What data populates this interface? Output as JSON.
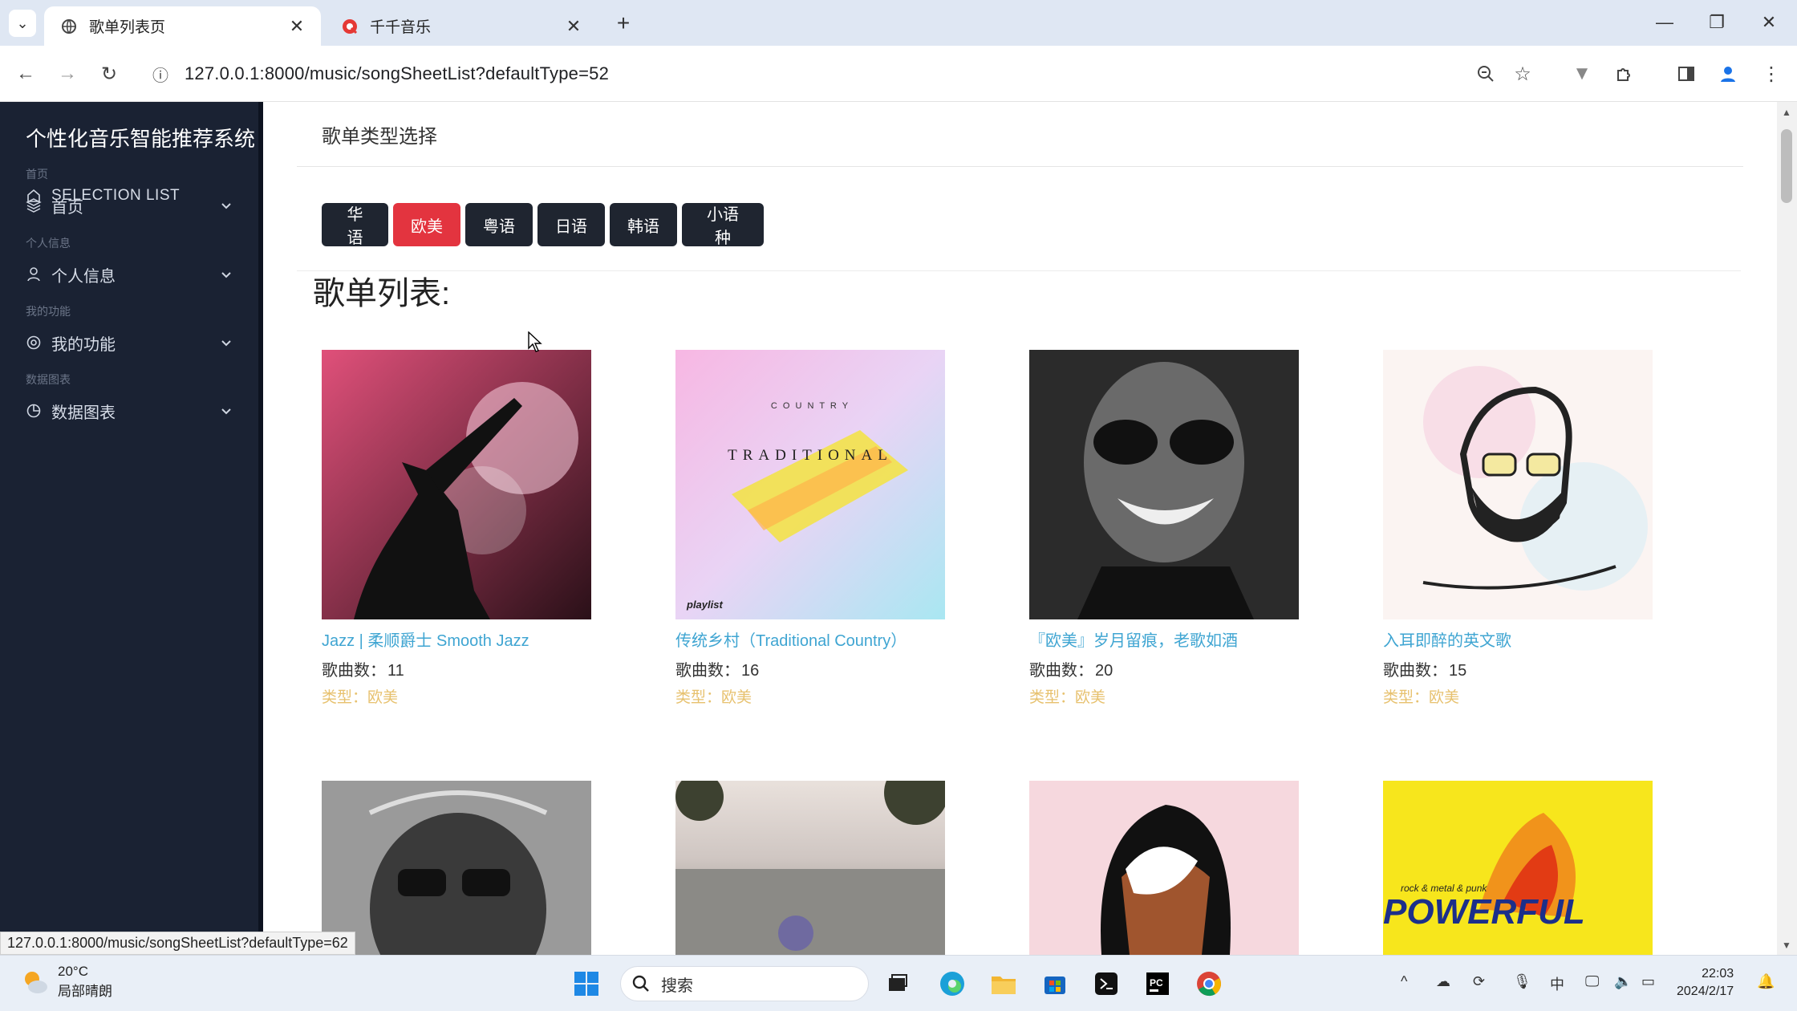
{
  "browser": {
    "tabs": [
      {
        "title": "歌单列表页",
        "active": true
      },
      {
        "title": "千千音乐",
        "active": false
      }
    ],
    "address": "127.0.0.1:8000/music/songSheetList?defaultType=52",
    "status_url": "127.0.0.1:8000/music/songSheetList?defaultType=62"
  },
  "sidebar": {
    "brand": "个性化音乐智能推荐系统",
    "selection_list": "SELECTION LIST",
    "sections": [
      {
        "header": "首页",
        "item": "首页",
        "icon": "layers-icon"
      },
      {
        "header": "个人信息",
        "item": "个人信息",
        "icon": "user-icon"
      },
      {
        "header": "我的功能",
        "item": "我的功能",
        "icon": "settings-icon"
      },
      {
        "header": "数据图表",
        "item": "数据图表",
        "icon": "pie-chart-icon"
      }
    ]
  },
  "main": {
    "type_heading": "歌单类型选择",
    "types": [
      "华语",
      "欧美",
      "粤语",
      "日语",
      "韩语",
      "小语种"
    ],
    "active_type": "欧美",
    "list_title": "歌单列表:",
    "count_label": "歌曲数：",
    "type_label": "类型：",
    "sheets": [
      {
        "title": "Jazz | 柔顺爵士 Smooth Jazz",
        "count": "11",
        "type": "欧美"
      },
      {
        "title": "传统乡村（Traditional Country）",
        "count": "16",
        "type": "欧美"
      },
      {
        "title": "『欧美』岁月留痕，老歌如酒",
        "count": "20",
        "type": "欧美"
      },
      {
        "title": "入耳即醉的英文歌",
        "count": "15",
        "type": "欧美"
      },
      {
        "title": "",
        "count": "",
        "type": ""
      },
      {
        "title": "",
        "count": "",
        "type": ""
      },
      {
        "title": "",
        "count": "",
        "type": ""
      },
      {
        "title": "",
        "count": "",
        "type": ""
      }
    ],
    "cover_texts": {
      "country_word": "C O U N T R Y",
      "traditional_word": "TRADITIONAL",
      "playlist_word": "playlist",
      "powerful_small": "rock & metal & punk",
      "powerful_word": "POWERFUL"
    },
    "colors": {
      "accent": "#e3343f",
      "link": "#3fa5d2",
      "type_text": "#e7c16e",
      "sidebar_bg": "#1a2233"
    }
  },
  "taskbar": {
    "weather_temp": "20°C",
    "weather_desc": "局部晴朗",
    "search_placeholder": "搜索",
    "ime": "中",
    "time": "22:03",
    "date": "2024/2/17"
  }
}
